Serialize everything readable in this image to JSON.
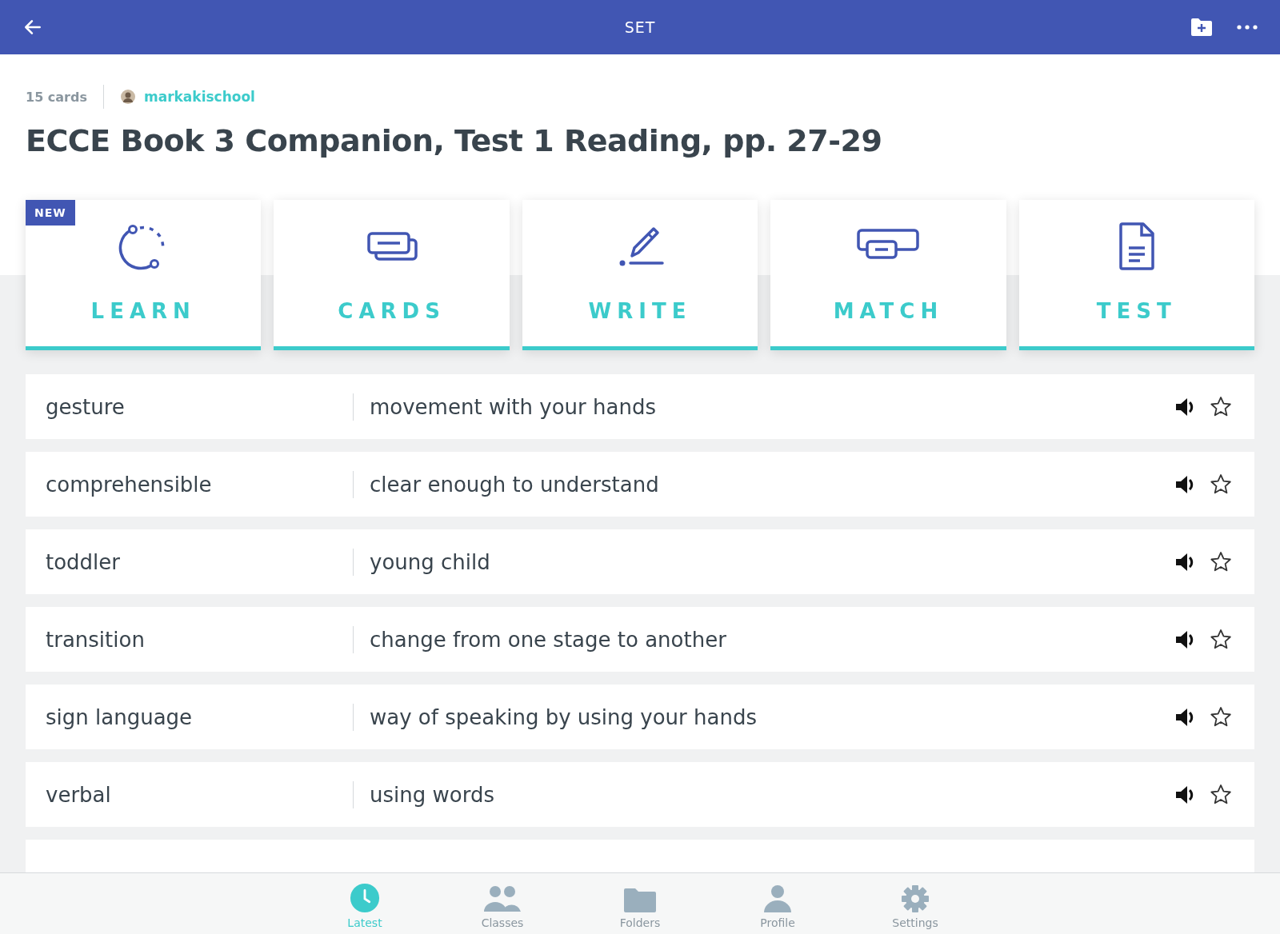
{
  "header": {
    "title": "SET"
  },
  "meta": {
    "count": "15 cards",
    "author": "markakischool"
  },
  "title": "ECCE Book 3 Companion, Test 1 Reading, pp. 27-29",
  "modes": [
    {
      "kind": "learn",
      "label": "LEARN",
      "badge": "NEW"
    },
    {
      "kind": "cards",
      "label": "CARDS"
    },
    {
      "kind": "write",
      "label": "WRITE"
    },
    {
      "kind": "match",
      "label": "MATCH"
    },
    {
      "kind": "test",
      "label": "TEST"
    }
  ],
  "terms": [
    {
      "term": "gesture",
      "definition": "movement with your hands",
      "starred": false
    },
    {
      "term": "comprehensible",
      "definition": "clear enough to understand",
      "starred": false
    },
    {
      "term": "toddler",
      "definition": "young child",
      "starred": false
    },
    {
      "term": "transition",
      "definition": "change from one stage to another",
      "starred": false
    },
    {
      "term": "sign language",
      "definition": "way of speaking by using your hands",
      "starred": false
    },
    {
      "term": "verbal",
      "definition": "using words",
      "starred": false
    }
  ],
  "tab_bar": [
    {
      "kind": "latest",
      "label": "Latest",
      "selected": true
    },
    {
      "kind": "classes",
      "label": "Classes",
      "selected": false
    },
    {
      "kind": "folders",
      "label": "Folders",
      "selected": false
    },
    {
      "kind": "profile",
      "label": "Profile",
      "selected": false
    },
    {
      "kind": "settings",
      "label": "Settings",
      "selected": false
    }
  ]
}
